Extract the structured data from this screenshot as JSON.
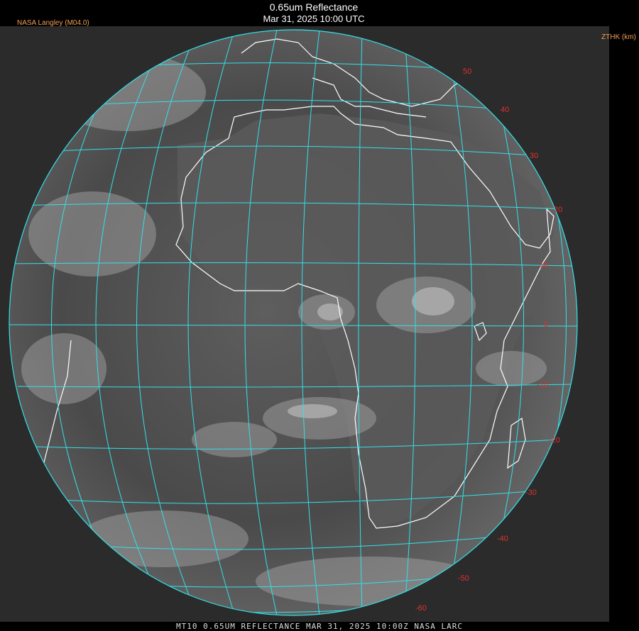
{
  "header": {
    "title": "0.65um Reflectance",
    "datetime": "Mar 31, 2025 10:00 UTC",
    "provider": "NASA Langley (M04.0)",
    "unit_label": "ZTHK (km)"
  },
  "footer": {
    "caption": "MT10  0.65UM REFLECTANCE   MAR 31, 2025 10:00Z   NASA LARC"
  },
  "globe": {
    "grid_color": "#33e0e8",
    "coast_color": "#ffffff",
    "label_color": "#e03030",
    "latitude_labels": [
      "50",
      "40",
      "30",
      "20",
      "10",
      "0",
      "-10",
      "-20",
      "-30",
      "-40",
      "-50",
      "-60"
    ]
  }
}
